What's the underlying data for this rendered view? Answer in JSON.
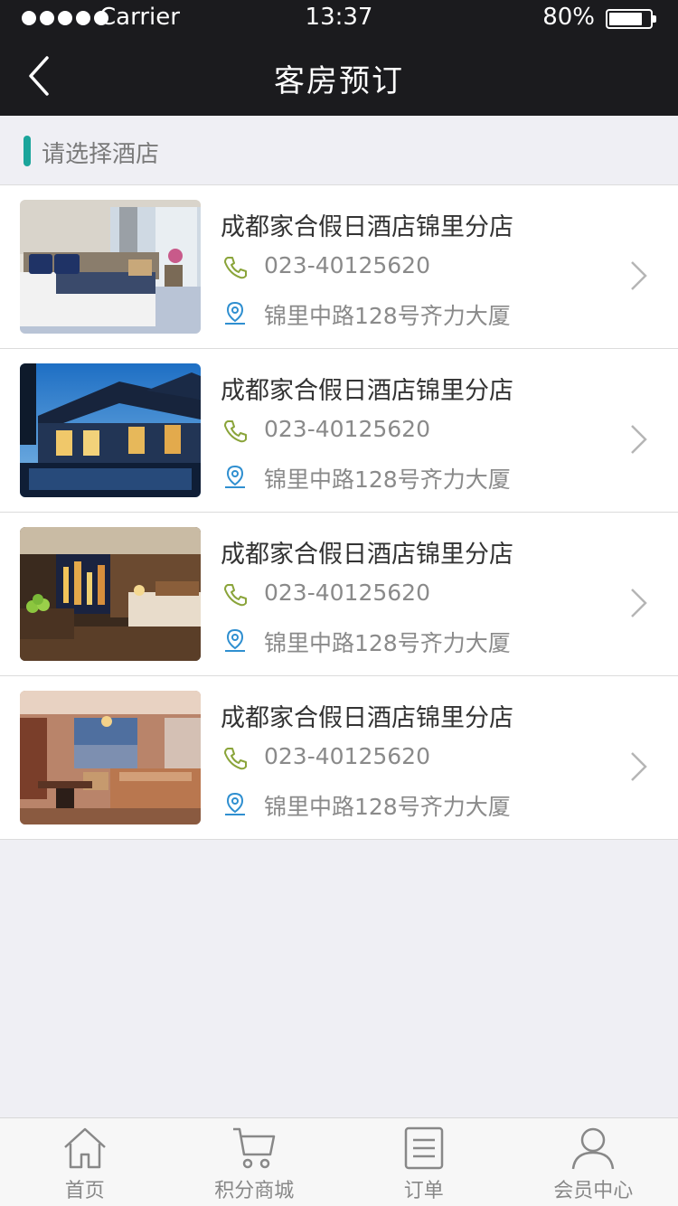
{
  "status": {
    "carrier": "Carrier",
    "time": "13:37",
    "battery": "80%"
  },
  "nav": {
    "title": "客房预订",
    "back_icon": "chevron-left-icon"
  },
  "section": {
    "title": "请选择酒店",
    "accent": "#1ba59b"
  },
  "hotels": [
    {
      "name": "成都家合假日酒店锦里分店",
      "phone": "023-40125620",
      "address": "锦里中路128号齐力大厦"
    },
    {
      "name": "成都家合假日酒店锦里分店",
      "phone": "023-40125620",
      "address": "锦里中路128号齐力大厦"
    },
    {
      "name": "成都家合假日酒店锦里分店",
      "phone": "023-40125620",
      "address": "锦里中路128号齐力大厦"
    },
    {
      "name": "成都家合假日酒店锦里分店",
      "phone": "023-40125620",
      "address": "锦里中路128号齐力大厦"
    }
  ],
  "tabs": [
    {
      "label": "首页",
      "icon": "home-icon"
    },
    {
      "label": "积分商城",
      "icon": "cart-icon"
    },
    {
      "label": "订单",
      "icon": "order-list-icon"
    },
    {
      "label": "会员中心",
      "icon": "user-icon"
    }
  ],
  "colors": {
    "phone_icon": "#8aa43a",
    "pin_icon": "#2f8fd0",
    "header_bg": "#1b1b1e"
  }
}
